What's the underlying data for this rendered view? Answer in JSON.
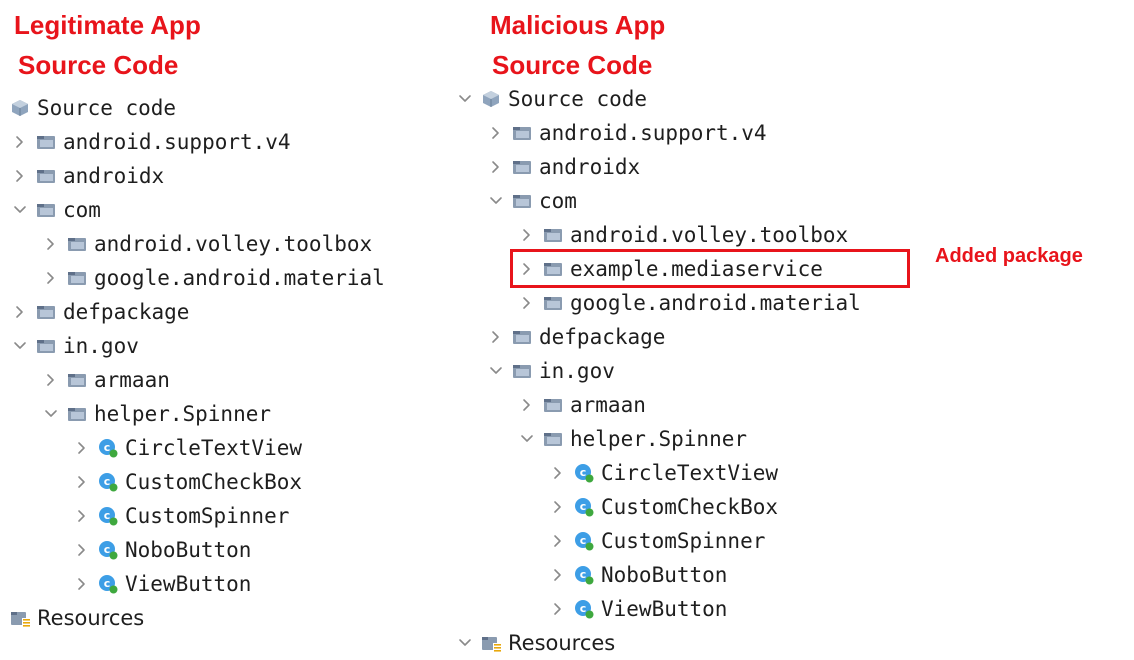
{
  "left_panel": {
    "title_line1": "Legitimate App",
    "title_line2": "Source Code",
    "tree": [
      {
        "label": "Source code",
        "depth": 0,
        "arrow": "none",
        "icon": "source-icon"
      },
      {
        "label": "android.support.v4",
        "depth": 0,
        "arrow": "collapsed",
        "icon": "package-icon"
      },
      {
        "label": "androidx",
        "depth": 0,
        "arrow": "collapsed",
        "icon": "package-icon"
      },
      {
        "label": "com",
        "depth": 0,
        "arrow": "expanded",
        "icon": "package-icon"
      },
      {
        "label": "android.volley.toolbox",
        "depth": 1,
        "arrow": "collapsed",
        "icon": "package-icon"
      },
      {
        "label": "google.android.material",
        "depth": 1,
        "arrow": "collapsed",
        "icon": "package-icon"
      },
      {
        "label": "defpackage",
        "depth": 0,
        "arrow": "collapsed",
        "icon": "package-icon"
      },
      {
        "label": "in.gov",
        "depth": 0,
        "arrow": "expanded",
        "icon": "package-icon"
      },
      {
        "label": "armaan",
        "depth": 1,
        "arrow": "collapsed",
        "icon": "package-icon"
      },
      {
        "label": "helper.Spinner",
        "depth": 1,
        "arrow": "expanded",
        "icon": "package-icon"
      },
      {
        "label": "CircleTextView",
        "depth": 2,
        "arrow": "collapsed",
        "icon": "class-icon"
      },
      {
        "label": "CustomCheckBox",
        "depth": 2,
        "arrow": "collapsed",
        "icon": "class-icon"
      },
      {
        "label": "CustomSpinner",
        "depth": 2,
        "arrow": "collapsed",
        "icon": "class-icon"
      },
      {
        "label": "NoboButton",
        "depth": 2,
        "arrow": "collapsed",
        "icon": "class-icon"
      },
      {
        "label": "ViewButton",
        "depth": 2,
        "arrow": "collapsed",
        "icon": "class-icon"
      },
      {
        "label": "Resources",
        "depth": -1,
        "arrow": "none",
        "icon": "resources-icon"
      }
    ]
  },
  "right_panel": {
    "title_line1": "Malicious App",
    "title_line2": "Source Code",
    "tree": [
      {
        "label": "Source code",
        "depth": 0,
        "arrow": "expanded",
        "icon": "source-icon"
      },
      {
        "label": "android.support.v4",
        "depth": 1,
        "arrow": "collapsed",
        "icon": "package-icon"
      },
      {
        "label": "androidx",
        "depth": 1,
        "arrow": "collapsed",
        "icon": "package-icon"
      },
      {
        "label": "com",
        "depth": 1,
        "arrow": "expanded",
        "icon": "package-icon"
      },
      {
        "label": "android.volley.toolbox",
        "depth": 2,
        "arrow": "collapsed",
        "icon": "package-icon"
      },
      {
        "label": "example.mediaservice",
        "depth": 2,
        "arrow": "collapsed",
        "icon": "package-icon",
        "highlighted": true
      },
      {
        "label": "google.android.material",
        "depth": 2,
        "arrow": "collapsed",
        "icon": "package-icon"
      },
      {
        "label": "defpackage",
        "depth": 1,
        "arrow": "collapsed",
        "icon": "package-icon"
      },
      {
        "label": "in.gov",
        "depth": 1,
        "arrow": "expanded",
        "icon": "package-icon"
      },
      {
        "label": "armaan",
        "depth": 2,
        "arrow": "collapsed",
        "icon": "package-icon"
      },
      {
        "label": "helper.Spinner",
        "depth": 2,
        "arrow": "expanded",
        "icon": "package-icon"
      },
      {
        "label": "CircleTextView",
        "depth": 3,
        "arrow": "collapsed",
        "icon": "class-icon"
      },
      {
        "label": "CustomCheckBox",
        "depth": 3,
        "arrow": "collapsed",
        "icon": "class-icon"
      },
      {
        "label": "CustomSpinner",
        "depth": 3,
        "arrow": "collapsed",
        "icon": "class-icon"
      },
      {
        "label": "NoboButton",
        "depth": 3,
        "arrow": "collapsed",
        "icon": "class-icon"
      },
      {
        "label": "ViewButton",
        "depth": 3,
        "arrow": "collapsed",
        "icon": "class-icon"
      },
      {
        "label": "Resources",
        "depth": 0,
        "arrow": "expanded",
        "icon": "resources-icon"
      }
    ],
    "annotation": "Added package"
  },
  "colors": {
    "title_red": "#e8141b",
    "package_icon": "#8a9bb0",
    "class_icon": "#3d9ee6",
    "class_badge": "#3ea83e",
    "arrow": "#8a8a8a"
  }
}
